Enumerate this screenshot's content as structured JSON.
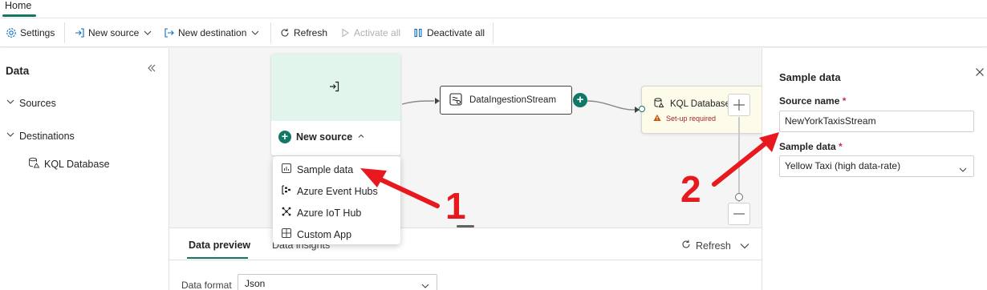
{
  "ribbon": {
    "tab_home": "Home"
  },
  "toolbar": {
    "settings": "Settings",
    "new_source": "New source",
    "new_destination": "New destination",
    "refresh": "Refresh",
    "activate_all": "Activate all",
    "deactivate_all": "Deactivate all"
  },
  "left_panel": {
    "title": "Data",
    "sources": "Sources",
    "destinations": "Destinations",
    "destination_items": [
      "KQL Database"
    ]
  },
  "canvas": {
    "new_source_button": "New source",
    "stream_node": "DataIngestionStream",
    "kql_node_title": "KQL Database",
    "kql_node_status": "Set-up required"
  },
  "dropdown": {
    "items": [
      "Sample data",
      "Azure Event Hubs",
      "Azure IoT Hub",
      "Custom App"
    ]
  },
  "bottom_panel": {
    "tab_preview": "Data preview",
    "tab_insights": "Data insights",
    "refresh": "Refresh",
    "format_label": "Data format",
    "format_value": "Json"
  },
  "right_panel": {
    "title": "Sample data",
    "source_name_label": "Source name",
    "source_name_value": "NewYorkTaxisStream",
    "sample_data_label": "Sample data",
    "sample_data_value": "Yellow Taxi (high data-rate)",
    "required_marker": "*"
  },
  "annotations": {
    "step1": "1",
    "step2": "2"
  },
  "colors": {
    "accent": "#117865",
    "annotation_red": "#e8191e",
    "warning": "#a4262c"
  }
}
